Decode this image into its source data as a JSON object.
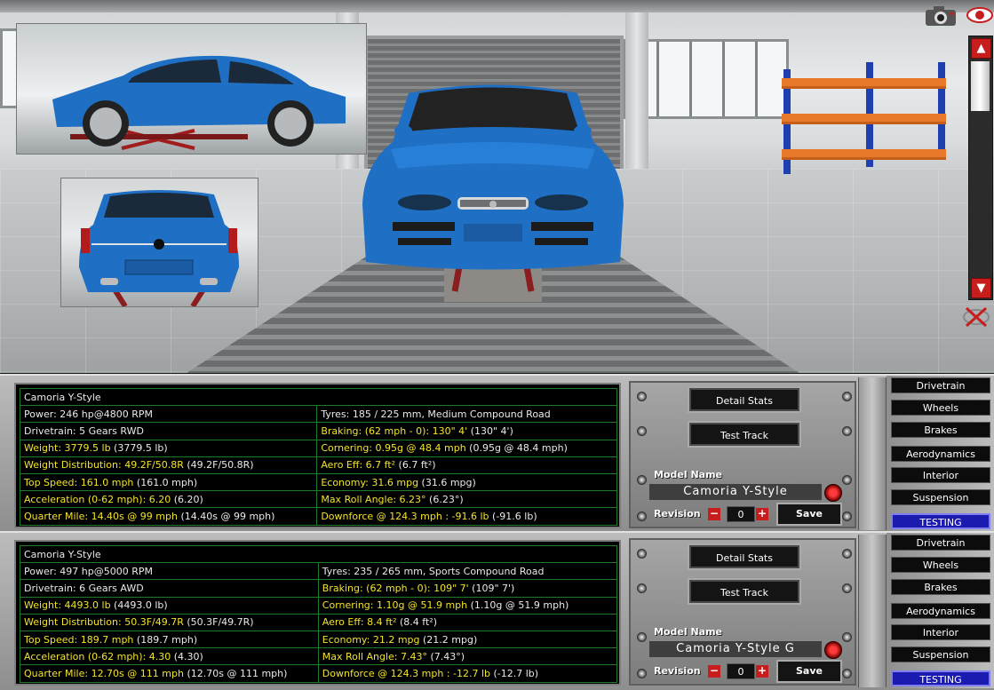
{
  "viewport": {
    "toolbar": {
      "camera": "camera-icon",
      "view": "eye-icon",
      "scroll_up": "▲",
      "scroll_down": "▼",
      "close_view": "close-view-icon"
    }
  },
  "panels": [
    {
      "title": "Camoria  Y-Style",
      "rows": [
        {
          "left": {
            "label": "Power: 246 hp@4800 RPM",
            "extra": "",
            "highlight": false
          },
          "right": {
            "label": "Tyres: 185 / 225 mm, Medium Compound Road",
            "extra": "",
            "highlight": false
          }
        },
        {
          "left": {
            "label": "Drivetrain: 5 Gears RWD",
            "extra": "",
            "highlight": false
          },
          "right": {
            "label": "Braking: (62 mph - 0): 130\" 4'",
            "extra": " (130\" 4')",
            "highlight": true
          }
        },
        {
          "left": {
            "label": "Weight: 3779.5 lb",
            "extra": " (3779.5 lb)",
            "highlight": true
          },
          "right": {
            "label": "Cornering: 0.95g @ 48.4 mph",
            "extra": " (0.95g @ 48.4 mph)",
            "highlight": true
          }
        },
        {
          "left": {
            "label": "Weight Distribution: 49.2F/50.8R",
            "extra": " (49.2F/50.8R)",
            "highlight": true
          },
          "right": {
            "label": "Aero Eff: 6.7 ft²",
            "extra": " (6.7 ft²)",
            "highlight": true
          }
        },
        {
          "left": {
            "label": "Top Speed: 161.0 mph",
            "extra": " (161.0 mph)",
            "highlight": true
          },
          "right": {
            "label": "Economy: 31.6 mpg",
            "extra": " (31.6 mpg)",
            "highlight": true
          }
        },
        {
          "left": {
            "label": "Acceleration (0-62 mph): 6.20",
            "extra": " (6.20)",
            "highlight": true
          },
          "right": {
            "label": "Max Roll Angle: 6.23°",
            "extra": " (6.23°)",
            "highlight": true
          }
        },
        {
          "left": {
            "label": "Quarter Mile: 14.40s @ 99 mph",
            "extra": " (14.40s @ 99 mph)",
            "highlight": true
          },
          "right": {
            "label": "Downforce @ 124.3 mph : -91.6 lb",
            "extra": " (-91.6 lb)",
            "highlight": true
          }
        }
      ],
      "detail_stats": "Detail Stats",
      "test_track": "Test Track",
      "model_name_label": "Model Name",
      "model_name": "Camoria Y-Style",
      "revision_label": "Revision",
      "revision_minus": "−",
      "revision_plus": "+",
      "revision": "0",
      "save": "Save",
      "menu": [
        "Drivetrain",
        "Wheels",
        "Brakes",
        "Aerodynamics",
        "Interior",
        "Suspension",
        "TESTING"
      ],
      "active_menu": "TESTING"
    },
    {
      "title": "Camoria  Y-Style",
      "rows": [
        {
          "left": {
            "label": "Power: 497 hp@5000 RPM",
            "extra": "",
            "highlight": false
          },
          "right": {
            "label": "Tyres: 235 / 265 mm, Sports Compound Road",
            "extra": "",
            "highlight": false
          }
        },
        {
          "left": {
            "label": "Drivetrain: 6 Gears AWD",
            "extra": "",
            "highlight": false
          },
          "right": {
            "label": "Braking: (62 mph - 0): 109\" 7'",
            "extra": " (109\" 7')",
            "highlight": true
          }
        },
        {
          "left": {
            "label": "Weight: 4493.0 lb",
            "extra": " (4493.0 lb)",
            "highlight": true
          },
          "right": {
            "label": "Cornering: 1.10g @ 51.9 mph",
            "extra": " (1.10g @ 51.9 mph)",
            "highlight": true
          }
        },
        {
          "left": {
            "label": "Weight Distribution: 50.3F/49.7R",
            "extra": " (50.3F/49.7R)",
            "highlight": true
          },
          "right": {
            "label": "Aero Eff: 8.4 ft²",
            "extra": " (8.4 ft²)",
            "highlight": true
          }
        },
        {
          "left": {
            "label": "Top Speed: 189.7 mph",
            "extra": " (189.7 mph)",
            "highlight": true
          },
          "right": {
            "label": "Economy: 21.2 mpg",
            "extra": " (21.2 mpg)",
            "highlight": true
          }
        },
        {
          "left": {
            "label": "Acceleration (0-62 mph): 4.30",
            "extra": " (4.30)",
            "highlight": true
          },
          "right": {
            "label": "Max Roll Angle: 7.43°",
            "extra": " (7.43°)",
            "highlight": true
          }
        },
        {
          "left": {
            "label": "Quarter Mile: 12.70s @ 111 mph",
            "extra": " (12.70s @ 111 mph)",
            "highlight": true
          },
          "right": {
            "label": "Downforce @ 124.3 mph : -12.7 lb",
            "extra": " (-12.7 lb)",
            "highlight": true
          }
        }
      ],
      "detail_stats": "Detail Stats",
      "test_track": "Test Track",
      "model_name_label": "Model Name",
      "model_name": "Camoria Y-Style G",
      "revision_label": "Revision",
      "revision_minus": "−",
      "revision_plus": "+",
      "revision": "0",
      "save": "Save",
      "menu": [
        "Drivetrain",
        "Wheels",
        "Brakes",
        "Aerodynamics",
        "Interior",
        "Suspension",
        "TESTING"
      ],
      "active_menu": "TESTING"
    }
  ],
  "colors": {
    "car_blue": "#1f6fc4",
    "stat_highlight": "#f2e42a",
    "grid_green": "#1f7a2a",
    "active_tab": "#1c1bb0",
    "accent_red": "#c81d1d"
  }
}
